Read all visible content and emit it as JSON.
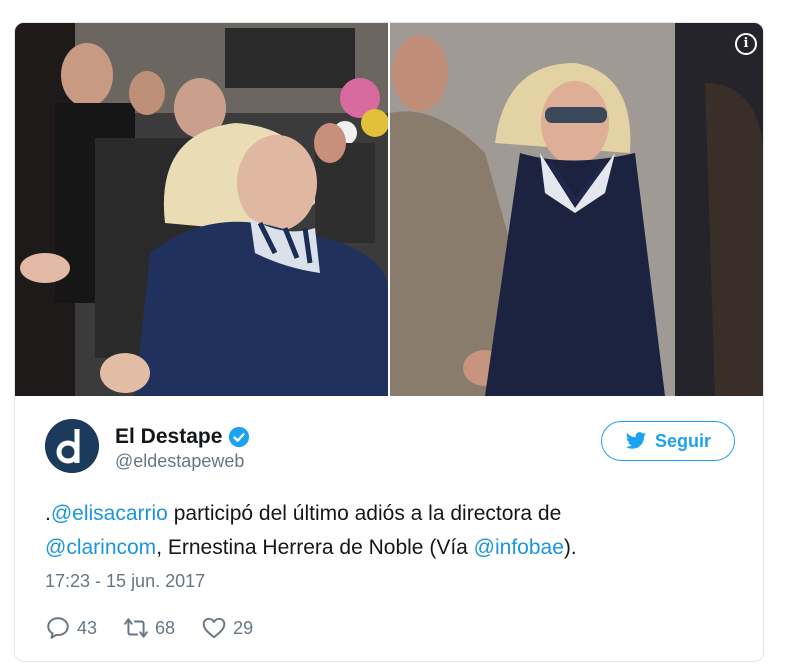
{
  "tweet": {
    "author_name": "El Destape",
    "author_handle": "@eldestapeweb",
    "follow_label": "Seguir",
    "text_prefix": ".",
    "mention_1": "@elisacarrio",
    "text_1": " participó del último adiós a la directora de",
    "mention_2": "@clarincom",
    "text_2": ", Ernestina Herrera de Noble (Vía ",
    "mention_3": "@infobae",
    "text_3": ").",
    "timestamp": "17:23 - 15 jun. 2017",
    "replies": "43",
    "retweets": "68",
    "likes": "29",
    "info_glyph": "i"
  },
  "icons": {
    "info": "info-icon",
    "verified": "verified-badge-icon",
    "bird": "twitter-bird-icon",
    "reply": "reply-icon",
    "retweet": "retweet-icon",
    "like": "heart-icon"
  },
  "colors": {
    "accent": "#1da1f2",
    "mention": "#1b95e0",
    "muted": "#657786",
    "text": "#14171a"
  }
}
